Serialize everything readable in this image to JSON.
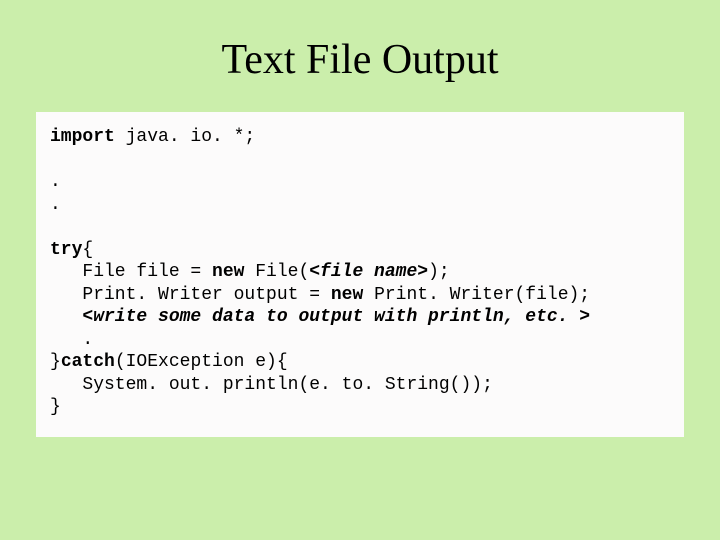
{
  "title": "Text File Output",
  "code": {
    "l1_kw": "import",
    "l1_rest": " java. io. *;",
    "l4_kw": "try",
    "l4_brace": "{",
    "l5a": "   File file = ",
    "l5kw": "new",
    "l5b": " File(",
    "l5arg": "<file name>",
    "l5c": ");",
    "l6a": "   Print. Writer output = ",
    "l6kw": "new",
    "l6b": " Print. Writer(file);",
    "l7": "   <write some data to output with println, etc. >",
    "l8": "   .",
    "l9a": "}",
    "l9kw": "catch",
    "l9b": "(IOException e){",
    "l10": "   System. out. println(e. to. String());",
    "l11": "}"
  }
}
